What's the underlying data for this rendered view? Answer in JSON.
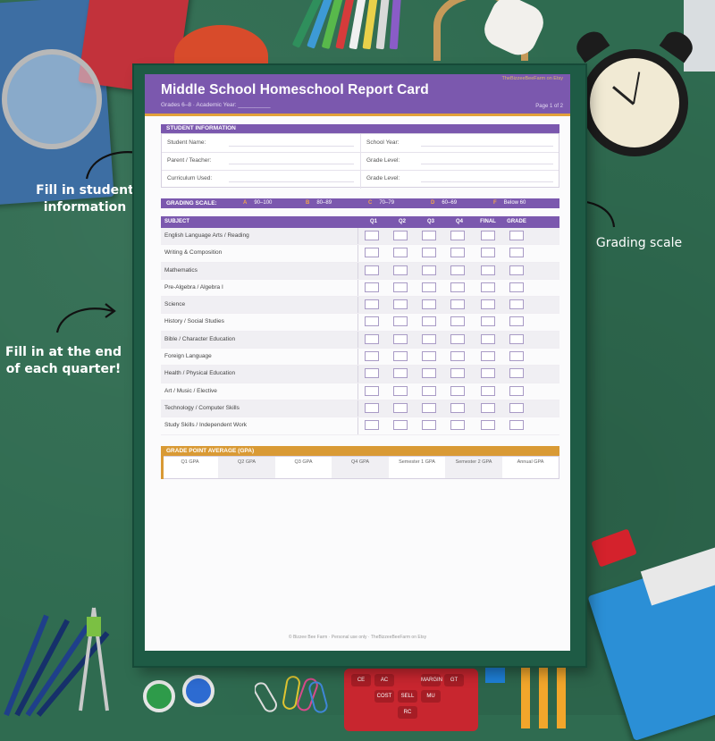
{
  "annotations": {
    "student_info": "Fill in student information",
    "grading_scale": "Grading scale",
    "quarter": "Fill in at the end of each quarter!"
  },
  "doc": {
    "title": "Middle School Homeschool Report Card",
    "subtitle": "Grades 6–8  ·  Academic Year: __________",
    "page": "Page 1 of 2",
    "top_note": "TheBizzeeBeeFarm on Etsy",
    "footer": "© Bizzee Bee Farm  ·  Personal use only  ·  TheBizzeeBeeFarm on Etsy"
  },
  "student_info": {
    "heading": "STUDENT INFORMATION",
    "left": [
      "Student Name:",
      "Parent / Teacher:",
      "Curriculum Used:"
    ],
    "right": [
      "School Year:",
      "Grade Level:",
      "Grade Level:"
    ]
  },
  "grading_scale": {
    "heading": "GRADING SCALE:",
    "items": [
      {
        "letter": "A",
        "range": "90–100"
      },
      {
        "letter": "B",
        "range": "80–89"
      },
      {
        "letter": "C",
        "range": "70–79"
      },
      {
        "letter": "D",
        "range": "60–69"
      },
      {
        "letter": "F",
        "range": "Below 60"
      }
    ]
  },
  "table": {
    "headers": [
      "SUBJECT",
      "Q1",
      "Q2",
      "Q3",
      "Q4",
      "FINAL",
      "GRADE"
    ],
    "subjects": [
      "English Language Arts / Reading",
      "Writing & Composition",
      "Mathematics",
      "Pre-Algebra / Algebra I",
      "Science",
      "History / Social Studies",
      "Bible / Character Education",
      "Foreign Language",
      "Health / Physical Education",
      "Art / Music / Elective",
      "Technology / Computer Skills",
      "Study Skills / Independent Work"
    ]
  },
  "gpa": {
    "heading": "GRADE POINT AVERAGE (GPA)",
    "cells": [
      "Q1 GPA",
      "Q2 GPA",
      "Q3 GPA",
      "Q4 GPA",
      "Semester 1 GPA",
      "Semester 2 GPA",
      "Annual GPA"
    ]
  },
  "calculator_keys": [
    "CE",
    "AC",
    "MARGIN",
    "GT",
    "COST",
    "SELL",
    "MU",
    "RC"
  ],
  "colors": {
    "background": "#2f6b50",
    "header_purple": "#7b58ae",
    "accent_gold": "#e2a03a",
    "scale_letter": "#f0a34d"
  }
}
